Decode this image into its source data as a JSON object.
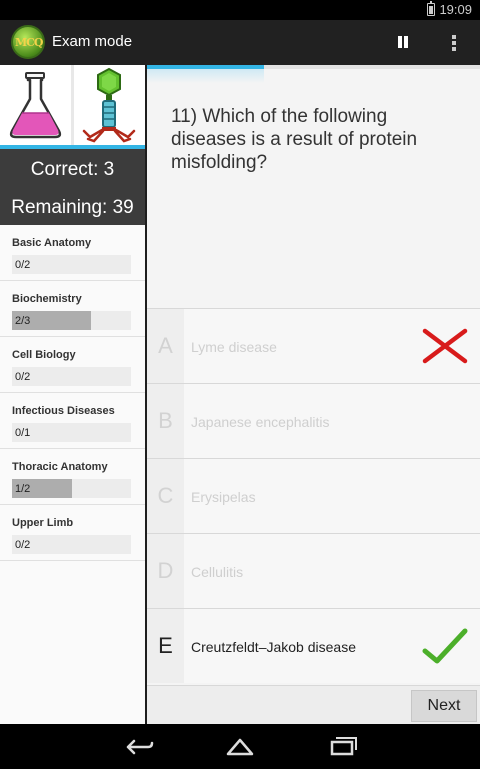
{
  "status_bar": {
    "time": "19:09"
  },
  "app": {
    "title": "Exam mode",
    "logo_text": "MCQ"
  },
  "score": {
    "correct_label": "Correct: 3",
    "remaining_label": "Remaining: 39"
  },
  "categories": [
    {
      "name": "Basic Anatomy",
      "value": "0/2",
      "fraction": 0
    },
    {
      "name": "Biochemistry",
      "value": "2/3",
      "fraction": 0.667
    },
    {
      "name": "Cell Biology",
      "value": "0/2",
      "fraction": 0
    },
    {
      "name": "Infectious Diseases",
      "value": "0/1",
      "fraction": 0
    },
    {
      "name": "Thoracic Anatomy",
      "value": "1/2",
      "fraction": 0.5
    },
    {
      "name": "Upper Limb",
      "value": "0/2",
      "fraction": 0
    }
  ],
  "exam": {
    "progress_fraction": 0.35,
    "question": "11) Which of the following diseases is a result of protein misfolding?",
    "options": [
      {
        "letter": "A",
        "text": "Lyme disease",
        "state": "wrong"
      },
      {
        "letter": "B",
        "text": "Japanese encephalitis",
        "state": "disabled"
      },
      {
        "letter": "C",
        "text": "Erysipelas",
        "state": "disabled"
      },
      {
        "letter": "D",
        "text": "Cellulitis",
        "state": "disabled"
      },
      {
        "letter": "E",
        "text": "Creutzfeldt–Jakob disease",
        "state": "correct"
      }
    ],
    "next_label": "Next"
  },
  "colors": {
    "accent": "#33b5e5",
    "wrong": "#d81b1b",
    "correct": "#4caf2a"
  }
}
